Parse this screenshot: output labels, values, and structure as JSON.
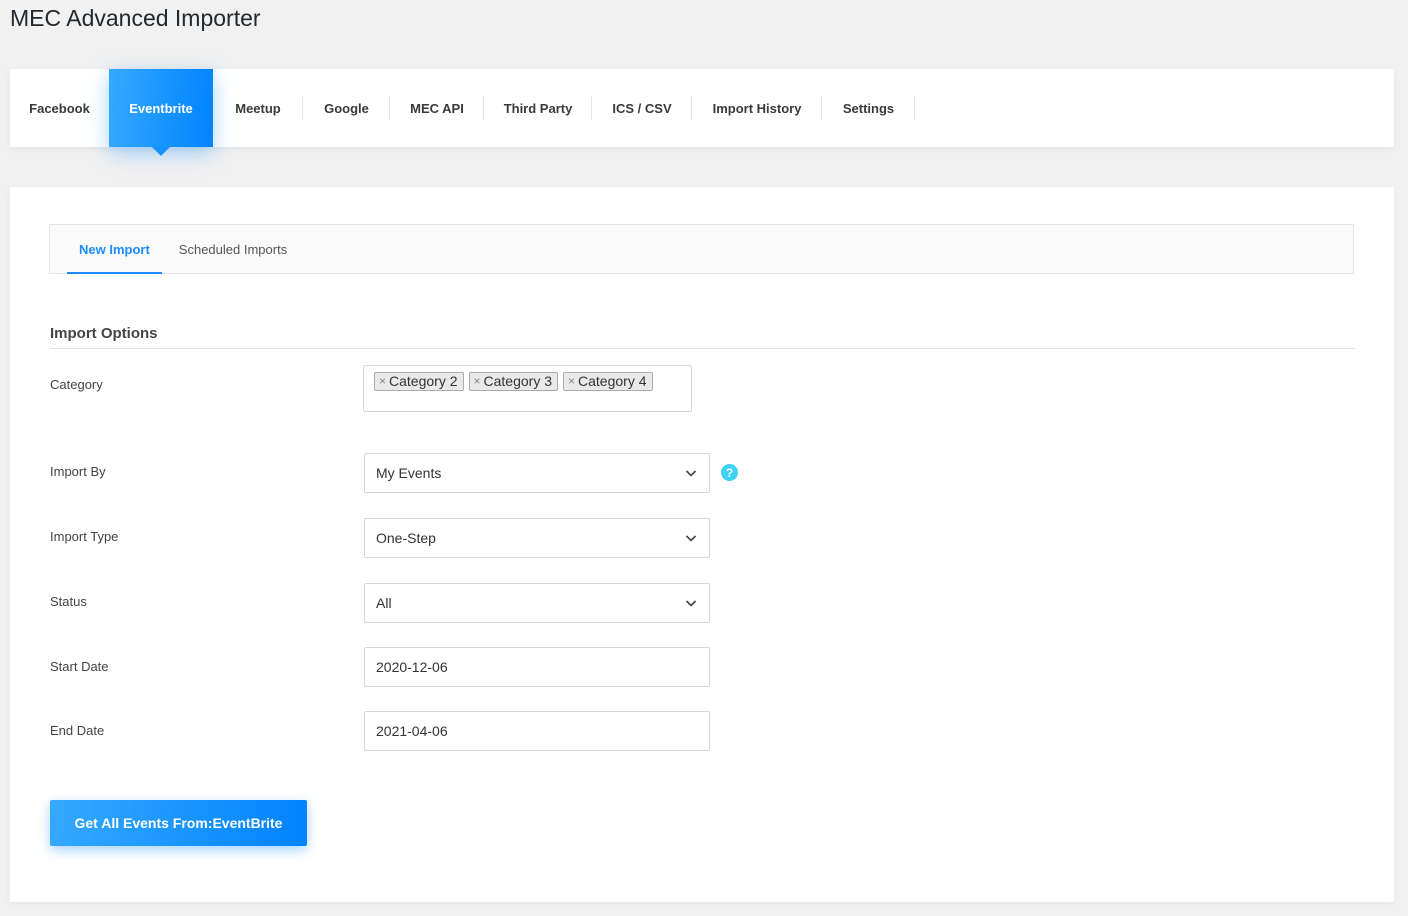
{
  "page_title": "MEC Advanced Importer",
  "top_tabs": [
    {
      "label": "Facebook",
      "active": false
    },
    {
      "label": "Eventbrite",
      "active": true
    },
    {
      "label": "Meetup",
      "active": false
    },
    {
      "label": "Google",
      "active": false
    },
    {
      "label": "MEC API",
      "active": false
    },
    {
      "label": "Third Party",
      "active": false
    },
    {
      "label": "ICS / CSV",
      "active": false
    },
    {
      "label": "Import History",
      "active": false
    },
    {
      "label": "Settings",
      "active": false
    }
  ],
  "sub_tabs": [
    {
      "label": "New Import",
      "active": true
    },
    {
      "label": "Scheduled Imports",
      "active": false
    }
  ],
  "section_title": "Import Options",
  "fields": {
    "category": {
      "label": "Category",
      "tags": [
        "Category 2",
        "Category 3",
        "Category 4"
      ],
      "remove_glyph": "×"
    },
    "import_by": {
      "label": "Import By",
      "value": "My Events",
      "help_glyph": "?"
    },
    "import_type": {
      "label": "Import Type",
      "value": "One-Step"
    },
    "status": {
      "label": "Status",
      "value": "All"
    },
    "start_date": {
      "label": "Start Date",
      "value": "2020-12-06"
    },
    "end_date": {
      "label": "End Date",
      "value": "2021-04-06"
    }
  },
  "submit_button": {
    "label": "Get All Events From:EventBrite"
  },
  "colors": {
    "accent": "#0083ff",
    "accent_light": "#36a9ff",
    "help_icon": "#3cd4f6",
    "page_bg": "#f1f1f1"
  }
}
